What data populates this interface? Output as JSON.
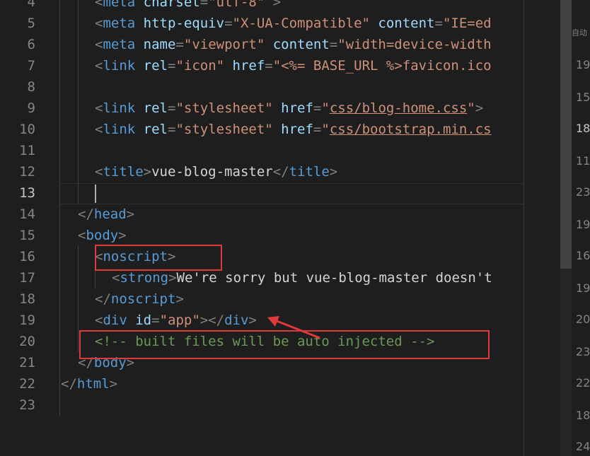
{
  "editor": {
    "current_line": 13,
    "lines": [
      {
        "num": "4",
        "parts": [
          [
            "p",
            "<"
          ],
          [
            "tag",
            "meta"
          ],
          [
            "attr",
            " charset"
          ],
          [
            "p",
            "="
          ],
          [
            "str",
            "\"utf-8\""
          ],
          [
            "p",
            " >"
          ]
        ]
      },
      {
        "num": "5",
        "parts": [
          [
            "p",
            "<"
          ],
          [
            "tag",
            "meta"
          ],
          [
            "attr",
            " http-equiv"
          ],
          [
            "p",
            "="
          ],
          [
            "str",
            "\"X-UA-Compatible\""
          ],
          [
            "attr",
            " content"
          ],
          [
            "p",
            "="
          ],
          [
            "str",
            "\"IE=ed"
          ]
        ]
      },
      {
        "num": "6",
        "parts": [
          [
            "p",
            "<"
          ],
          [
            "tag",
            "meta"
          ],
          [
            "attr",
            " name"
          ],
          [
            "p",
            "="
          ],
          [
            "str",
            "\"viewport\""
          ],
          [
            "attr",
            " content"
          ],
          [
            "p",
            "="
          ],
          [
            "str",
            "\"width=device-width"
          ]
        ]
      },
      {
        "num": "7",
        "parts": [
          [
            "p",
            "<"
          ],
          [
            "tag",
            "link"
          ],
          [
            "attr",
            " rel"
          ],
          [
            "p",
            "="
          ],
          [
            "str",
            "\"icon\""
          ],
          [
            "attr",
            " href"
          ],
          [
            "p",
            "="
          ],
          [
            "str",
            "\"<%= BASE_URL %>favicon.ico"
          ]
        ]
      },
      {
        "num": "8",
        "parts": []
      },
      {
        "num": "9",
        "parts": [
          [
            "p",
            "<"
          ],
          [
            "tag",
            "link"
          ],
          [
            "attr",
            " rel"
          ],
          [
            "p",
            "="
          ],
          [
            "str",
            "\"stylesheet\""
          ],
          [
            "attr",
            " href"
          ],
          [
            "p",
            "="
          ],
          [
            "str",
            "\""
          ],
          [
            "stru",
            "css/blog-home.css"
          ],
          [
            "str",
            "\""
          ],
          [
            "p",
            ">"
          ]
        ]
      },
      {
        "num": "10",
        "parts": [
          [
            "p",
            "<"
          ],
          [
            "tag",
            "link"
          ],
          [
            "attr",
            " rel"
          ],
          [
            "p",
            "="
          ],
          [
            "str",
            "\"stylesheet\""
          ],
          [
            "attr",
            " href"
          ],
          [
            "p",
            "="
          ],
          [
            "str",
            "\""
          ],
          [
            "stru",
            "css/bootstrap.min.cs"
          ]
        ]
      },
      {
        "num": "11",
        "parts": []
      },
      {
        "num": "12",
        "parts": [
          [
            "p",
            "<"
          ],
          [
            "tag",
            "title"
          ],
          [
            "p",
            ">"
          ],
          [
            "txt",
            "vue-blog-master"
          ],
          [
            "p",
            "</"
          ],
          [
            "tag",
            "title"
          ],
          [
            "p",
            ">"
          ]
        ]
      },
      {
        "num": "13",
        "parts": []
      },
      {
        "num": "14",
        "parts": [
          [
            "p",
            "</"
          ],
          [
            "tag",
            "head"
          ],
          [
            "p",
            ">"
          ]
        ]
      },
      {
        "num": "15",
        "parts": [
          [
            "p",
            "<"
          ],
          [
            "tag",
            "body"
          ],
          [
            "p",
            ">"
          ]
        ]
      },
      {
        "num": "16",
        "parts": [
          [
            "p",
            "<"
          ],
          [
            "tag",
            "noscript"
          ],
          [
            "p",
            ">"
          ]
        ]
      },
      {
        "num": "17",
        "parts": [
          [
            "p",
            "<"
          ],
          [
            "tag",
            "strong"
          ],
          [
            "p",
            ">"
          ],
          [
            "txt",
            "We're sorry but vue-blog-master doesn't"
          ]
        ]
      },
      {
        "num": "18",
        "parts": [
          [
            "p",
            "</"
          ],
          [
            "tag",
            "noscript"
          ],
          [
            "p",
            ">"
          ]
        ]
      },
      {
        "num": "19",
        "parts": [
          [
            "p",
            "<"
          ],
          [
            "tag",
            "div"
          ],
          [
            "attr",
            " id"
          ],
          [
            "p",
            "="
          ],
          [
            "str",
            "\"app\""
          ],
          [
            "p",
            "></"
          ],
          [
            "tag",
            "div"
          ],
          [
            "p",
            ">"
          ]
        ]
      },
      {
        "num": "20",
        "parts": [
          [
            "com",
            "<!-- built files will be auto injected -->"
          ]
        ]
      },
      {
        "num": "21",
        "parts": [
          [
            "p",
            "</"
          ],
          [
            "tag",
            "body"
          ],
          [
            "p",
            ">"
          ]
        ]
      },
      {
        "num": "22",
        "parts": [
          [
            "p",
            "</"
          ],
          [
            "tag",
            "html"
          ],
          [
            "p",
            ">"
          ]
        ]
      },
      {
        "num": "23",
        "parts": []
      }
    ]
  },
  "right_panel": {
    "label": "自动",
    "numbers": [
      "19",
      "15",
      "18",
      "11",
      "23",
      "19",
      "16",
      "19",
      "20",
      "23",
      "22",
      "18",
      "24"
    ],
    "current_index": 2
  },
  "colors": {
    "background": "#1e1e1e",
    "tag": "#569cd6",
    "attribute": "#9cdcfe",
    "string": "#ce9178",
    "punctuation": "#808080",
    "comment": "#6a9955",
    "annotation": "#e0393a"
  }
}
